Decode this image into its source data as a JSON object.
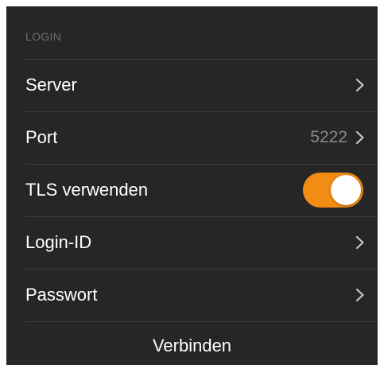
{
  "section": {
    "header": "LOGIN"
  },
  "rows": [
    {
      "label": "Server",
      "value": ""
    },
    {
      "label": "Port",
      "value": "5222"
    },
    {
      "label": "TLS verwenden",
      "toggle_on": true
    },
    {
      "label": "Login-ID",
      "value": ""
    },
    {
      "label": "Passwort",
      "value": ""
    }
  ],
  "action": {
    "label": "Verbinden"
  },
  "colors": {
    "background": "#262626",
    "separator": "#3d3d3d",
    "header_text": "#6e6e6e",
    "value_text": "#8a8a8a",
    "toggle_on": "#f28c13",
    "text": "#ffffff"
  },
  "icons": {
    "disclosure": "chevron-right-icon"
  }
}
